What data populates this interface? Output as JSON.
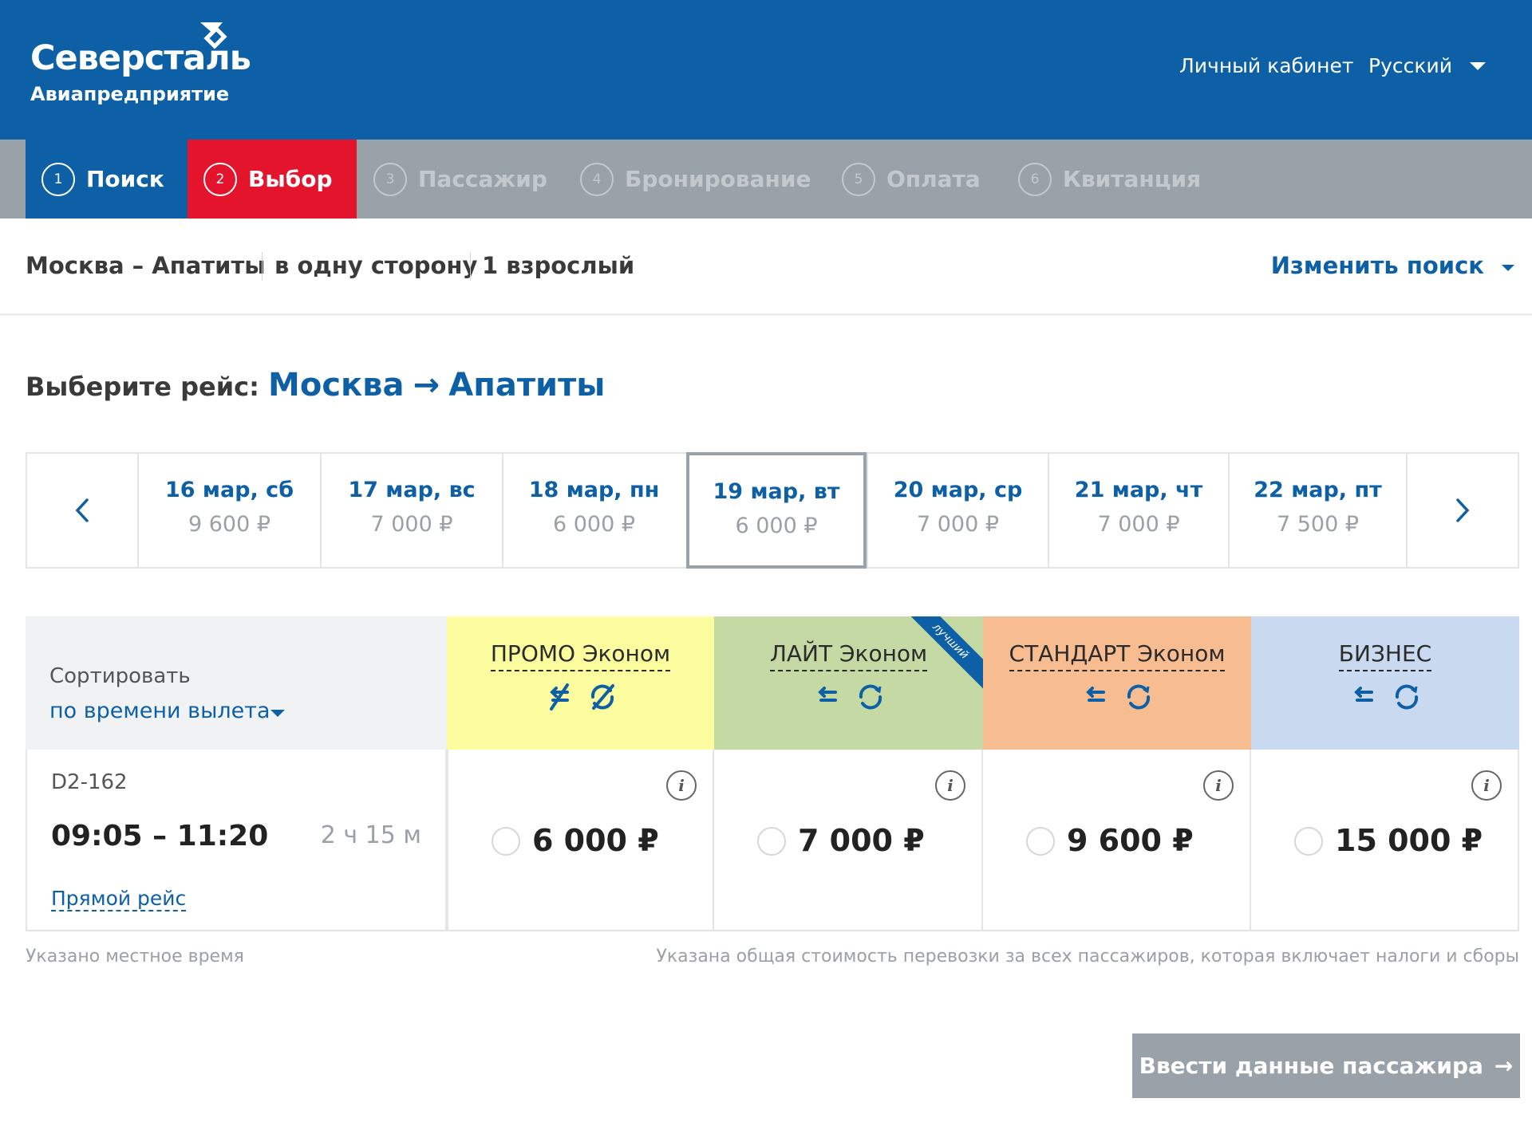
{
  "header": {
    "logo_name": "Северсталь",
    "logo_sub": "Авиапредприятие",
    "cabinet": "Личный кабинет",
    "language": "Русский"
  },
  "steps": [
    {
      "num": "1",
      "label": "Поиск",
      "state": "done"
    },
    {
      "num": "2",
      "label": "Выбор",
      "state": "active"
    },
    {
      "num": "3",
      "label": "Пассажир",
      "state": "pending"
    },
    {
      "num": "4",
      "label": "Бронирование",
      "state": "pending"
    },
    {
      "num": "5",
      "label": "Оплата",
      "state": "pending"
    },
    {
      "num": "6",
      "label": "Квитанция",
      "state": "pending"
    }
  ],
  "summary": {
    "route": "Москва – Апатиты",
    "trip_type": "в одну сторону",
    "passengers": "1 взрослый",
    "change_search": "Изменить поиск"
  },
  "select": {
    "label": "Выберите рейс:",
    "from": "Москва",
    "arrow": "→",
    "to": "Апатиты"
  },
  "dates": [
    {
      "date": "16 мар, сб",
      "price": "9 600 ₽"
    },
    {
      "date": "17 мар, вс",
      "price": "7 000 ₽"
    },
    {
      "date": "18 мар, пн",
      "price": "6 000 ₽"
    },
    {
      "date": "19 мар, вт",
      "price": "6 000 ₽",
      "selected": true
    },
    {
      "date": "20 мар, ср",
      "price": "7 000 ₽"
    },
    {
      "date": "21 мар, чт",
      "price": "7 000 ₽"
    },
    {
      "date": "22 мар, пт",
      "price": "7 500 ₽"
    }
  ],
  "sort": {
    "label": "Сортировать",
    "value": "по времени вылета"
  },
  "fares": [
    {
      "name": "ПРОМО Эконом",
      "color": "#fbfd9e",
      "price": "6 000 ₽",
      "icons": "no-refund-icon no-exchange-icon"
    },
    {
      "name": "ЛАЙТ Эконом",
      "color": "#c5d9a4",
      "price": "7 000 ₽",
      "badge": "лучший",
      "icons": "refund-icon exchange-icon"
    },
    {
      "name": "СТАНДАРТ Эконом",
      "color": "#f7bc90",
      "price": "9 600 ₽",
      "icons": "refund-icon exchange-icon"
    },
    {
      "name": "БИЗНЕС",
      "color": "#c9daf0",
      "price": "15 000 ₽",
      "icons": "refund-icon exchange-icon"
    }
  ],
  "flight": {
    "number": "D2-162",
    "time": "09:05 – 11:20",
    "duration": "2 ч 15 м",
    "type": "Прямой рейс"
  },
  "notes": {
    "local_time": "Указано местное время",
    "total_cost": "Указана общая стоимость перевозки за всех пассажиров, которая включает налоги и сборы"
  },
  "next_button": "Ввести данные пассажира",
  "next_arrow": "→",
  "colors": {
    "brand_blue": "#0d60a5",
    "active_red": "#e3142c",
    "steps_gray": "#9aa2a9"
  }
}
